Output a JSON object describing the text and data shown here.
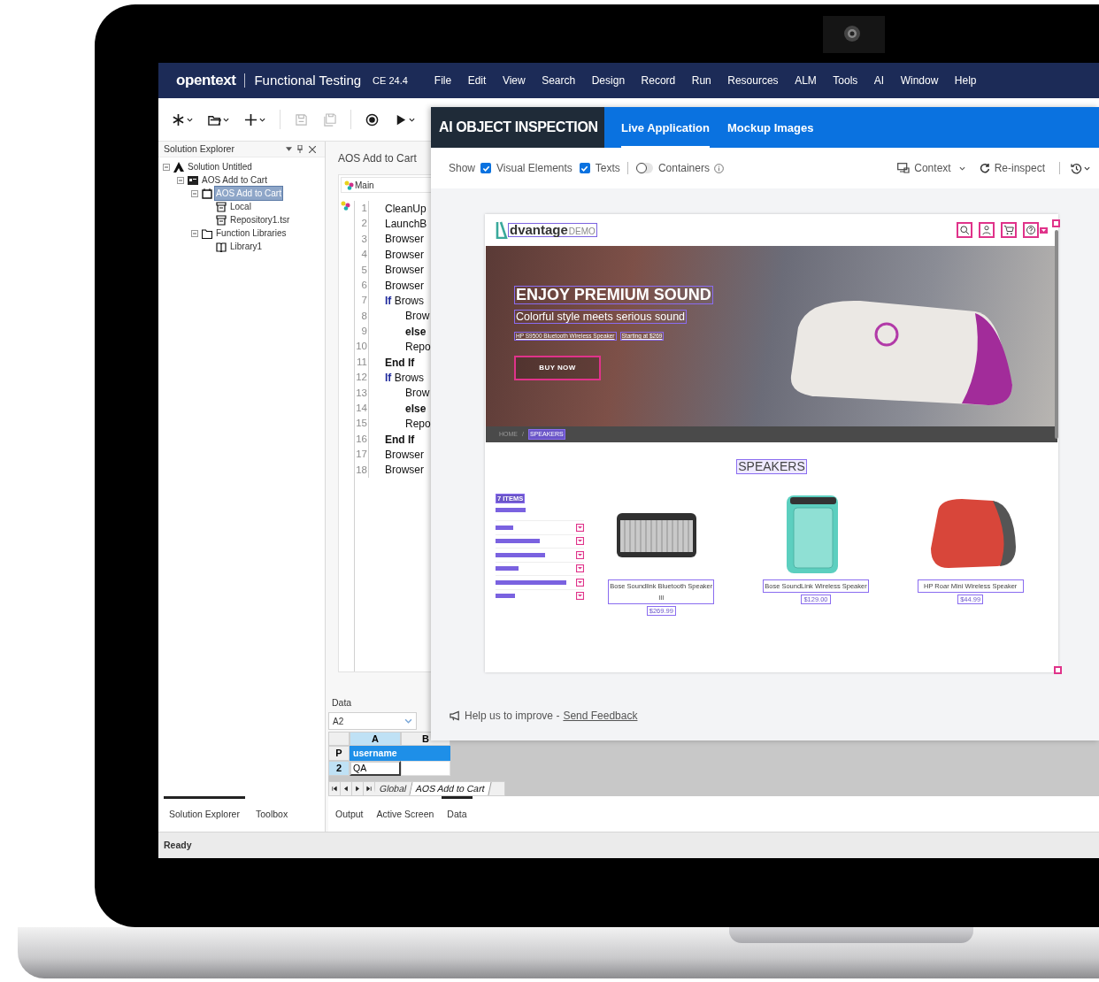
{
  "app_bar": {
    "brand": "opentext",
    "product": "Functional Testing",
    "version": "CE 24.4",
    "menus": [
      "File",
      "Edit",
      "View",
      "Search",
      "Design",
      "Record",
      "Run",
      "Resources",
      "ALM",
      "Tools",
      "AI",
      "Window",
      "Help"
    ]
  },
  "toolbar": [
    {
      "kind": "new",
      "caret": true,
      "disabled": false
    },
    {
      "kind": "open",
      "caret": true,
      "disabled": false
    },
    {
      "kind": "add",
      "caret": true,
      "disabled": false
    },
    {
      "kind": "save",
      "caret": false,
      "disabled": true
    },
    {
      "kind": "save_all",
      "caret": false,
      "disabled": true
    },
    {
      "kind": "record",
      "caret": false,
      "disabled": false
    },
    {
      "kind": "run",
      "caret": true,
      "disabled": false
    }
  ],
  "solution_explorer": {
    "title": "Solution Explorer",
    "tree": [
      {
        "label": "Solution Untitled",
        "kind": "solution",
        "expanded": true,
        "selected": false,
        "children": [
          {
            "label": "AOS Add to Cart",
            "kind": "test",
            "expanded": true,
            "selected": false,
            "children": [
              {
                "label": "AOS Add to Cart",
                "kind": "action",
                "expanded": true,
                "selected": true,
                "children": [
                  {
                    "label": "Local",
                    "kind": "repository",
                    "selected": false
                  },
                  {
                    "label": "Repository1.tsr",
                    "kind": "repository",
                    "selected": false
                  }
                ]
              },
              {
                "label": "Function Libraries",
                "kind": "folder",
                "expanded": true,
                "selected": false,
                "children": [
                  {
                    "label": "Library1",
                    "kind": "library",
                    "selected": false
                  }
                ]
              }
            ]
          }
        ]
      }
    ]
  },
  "editor": {
    "title": "AOS Add to Cart",
    "section": "Main",
    "lines": [
      {
        "number": "1",
        "kind": "code",
        "text": "CleanUp"
      },
      {
        "number": "2",
        "kind": "code",
        "text": "LaunchB"
      },
      {
        "number": "3",
        "kind": "code",
        "text": "Browser"
      },
      {
        "number": "4",
        "kind": "code",
        "text": "Browser"
      },
      {
        "number": "5",
        "kind": "code",
        "text": "Browser"
      },
      {
        "number": "6",
        "kind": "code",
        "text": "Browser"
      },
      {
        "number": "7",
        "kind": "code",
        "text": "**If** Brows",
        "children": [
          {
            "number": "8",
            "kind": "code",
            "text": "Brow"
          },
          {
            "number": "9",
            "kind": "keyword",
            "text": "else"
          },
          {
            "number": "10",
            "kind": "code",
            "text": "Repo"
          }
        ]
      },
      {
        "number": "11",
        "kind": "keyword",
        "text": "End If"
      },
      {
        "number": "12",
        "kind": "code",
        "text": "**If** Brows",
        "children": [
          {
            "number": "13",
            "kind": "code",
            "text": "Brow"
          },
          {
            "number": "14",
            "kind": "keyword",
            "text": "else"
          },
          {
            "number": "15",
            "kind": "code",
            "text": "Repo"
          }
        ]
      },
      {
        "number": "16",
        "kind": "keyword",
        "text": "End If"
      },
      {
        "number": "17",
        "kind": "code",
        "text": "Browser"
      },
      {
        "number": "18",
        "kind": "code",
        "text": "Browser"
      }
    ]
  },
  "data_panel": {
    "title": "Data",
    "cell_ref": "A2",
    "columns": [
      "A",
      "B"
    ],
    "rows": [
      {
        "label": "P",
        "kind": "parameter",
        "value": "username",
        "selected": false
      },
      {
        "label": "2",
        "kind": "data",
        "value": "QA",
        "selected": true
      }
    ],
    "sheets": [
      {
        "label": "Global",
        "selected": false
      },
      {
        "label": "AOS Add to Cart",
        "selected": true
      }
    ]
  },
  "left_tabs": [
    {
      "label": "Solution Explorer",
      "selected": true
    },
    {
      "label": "Toolbox",
      "selected": false
    }
  ],
  "bottom_tabs": [
    {
      "label": "Output",
      "selected": false
    },
    {
      "label": "Active Screen",
      "selected": false
    },
    {
      "label": "Data",
      "selected": true
    }
  ],
  "status_bar": {
    "text": "Ready"
  },
  "ai_panel": {
    "title": "AI OBJECT INSPECTION",
    "tabs": [
      {
        "label": "Live Application",
        "selected": true
      },
      {
        "label": "Mockup Images",
        "selected": false
      }
    ],
    "show_label": "Show",
    "checks": [
      {
        "label": "Visual Elements",
        "checked": true
      },
      {
        "label": "Texts",
        "checked": true
      }
    ],
    "toggle": {
      "label": "Containers",
      "on": false
    },
    "actions": [
      {
        "label": "Context",
        "kind": "context"
      },
      {
        "label": "Re-inspect",
        "kind": "reinspect"
      }
    ],
    "preview": {
      "logo": "dvantage",
      "logo_suffix": "DEMO",
      "hero": {
        "title": "ENJOY PREMIUM SOUND",
        "subtitle": "Colorful style meets serious sound",
        "links": [
          "HP S9500 Bluetooth Wireless Speaker",
          "Starting at $269"
        ],
        "button": "BUY NOW"
      },
      "breadcrumb": [
        {
          "label": "HOME",
          "selected": false
        },
        {
          "label": "SPEAKERS",
          "selected": true
        }
      ],
      "separator": "/",
      "heading": "SPEAKERS",
      "count": "7 ITEMS",
      "products": [
        {
          "name": "Bose Soundlink Bluetooth Speaker III",
          "price": "$269.99",
          "kind": "silver"
        },
        {
          "name": "Bose SoundLink Wireless Speaker",
          "price": "$129.00",
          "kind": "teal"
        },
        {
          "name": "HP Roar Mini Wireless Speaker",
          "price": "$44.99",
          "kind": "red"
        }
      ]
    },
    "feedback": {
      "text": "Help us to improve -",
      "link": "Send Feedback"
    }
  }
}
